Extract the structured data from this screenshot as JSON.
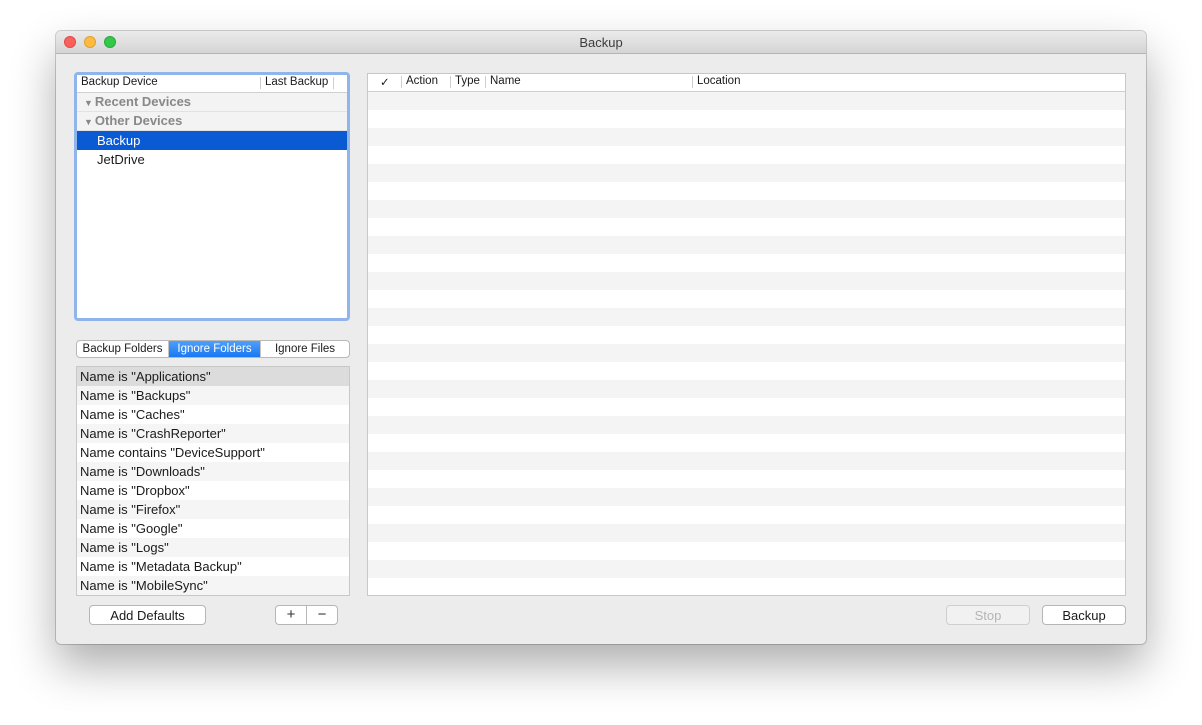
{
  "window": {
    "title": "Backup"
  },
  "devices": {
    "headers": [
      "Backup Device",
      "Last Backup"
    ],
    "groups": [
      {
        "label": "Recent Devices"
      },
      {
        "label": "Other Devices"
      }
    ],
    "items": [
      {
        "label": "Backup",
        "selected": true
      },
      {
        "label": "JetDrive",
        "selected": false
      }
    ]
  },
  "tabs": {
    "items": [
      "Backup Folders",
      "Ignore Folders",
      "Ignore Files"
    ],
    "selected": "Ignore Folders"
  },
  "ignore_list": [
    "Name is \"Applications\"",
    "Name is \"Backups\"",
    "Name is \"Caches\"",
    "Name is \"CrashReporter\"",
    "Name contains \"DeviceSupport\"",
    "Name is \"Downloads\"",
    "Name is \"Dropbox\"",
    "Name is \"Firefox\"",
    "Name is \"Google\"",
    "Name is \"Logs\"",
    "Name is \"Metadata Backup\"",
    "Name is \"MobileSync\""
  ],
  "actions_table": {
    "headers": [
      "✓",
      "Action",
      "Type",
      "Name",
      "Location"
    ]
  },
  "buttons": {
    "add_defaults": "Add Defaults",
    "plus": "+",
    "minus": "−",
    "stop": "Stop",
    "backup": "Backup"
  },
  "colors": {
    "selection": "#0a5ad4",
    "segment_selected": "#1877f2",
    "focus_ring": "#8fb5ea"
  }
}
